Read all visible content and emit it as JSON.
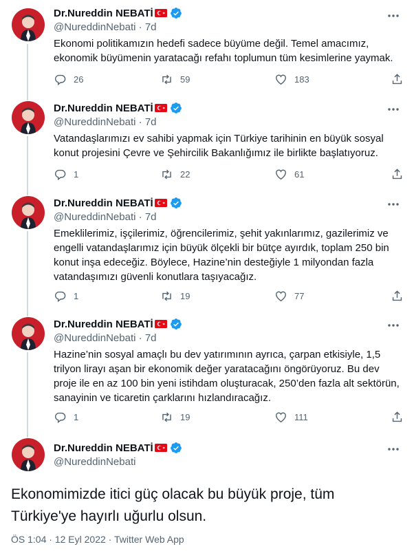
{
  "colors": {
    "verified": "#1d9bf0",
    "muted": "#536471",
    "text": "#0f1419",
    "thread_line": "#cfd9de",
    "flag_red": "#e30a17"
  },
  "icons": {
    "reply": "speech-bubble-icon",
    "retweet": "retweet-arrows-icon",
    "like": "heart-icon",
    "share": "share-icon",
    "more": "more-dots-icon",
    "verified": "verified-badge-icon",
    "flag": "turkey-flag-icon"
  },
  "author": {
    "name": "Dr.Nureddin NEBATİ",
    "handle": "@NureddinNebati"
  },
  "tweets": [
    {
      "age": "7d",
      "text": "Ekonomi politikamızın hedefi sadece büyüme değil. Temel amacımız, ekonomik büyümenin yaratacağı refahı toplumun tüm kesimlerine yaymak.",
      "replies": "26",
      "retweets": "59",
      "likes": "183"
    },
    {
      "age": "7d",
      "text": "Vatandaşlarımızı ev sahibi yapmak için Türkiye tarihinin en büyük sosyal konut projesini Çevre ve Şehircilik Bakanlığımız ile birlikte başlatıyoruz.",
      "replies": "1",
      "retweets": "22",
      "likes": "61"
    },
    {
      "age": "7d",
      "text": "Emeklilerimiz, işçilerimiz, öğrencilerimiz, şehit yakınlarımız, gazilerimiz ve engelli vatandaşlarımız için büyük ölçekli bir bütçe ayırdık, toplam 250 bin konut inşa edeceğiz. Böylece, Hazine’nin desteğiyle 1 milyondan fazla vatandaşımızı güvenli konutlara taşıyacağız.",
      "replies": "1",
      "retweets": "19",
      "likes": "77"
    },
    {
      "age": "7d",
      "text": "Hazine’nin sosyal amaçlı bu dev yatırımının ayrıca, çarpan etkisiyle, 1,5 trilyon lirayı aşan bir ekonomik değer yaratacağını öngörüyoruz. Bu dev proje ile en az 100 bin yeni istihdam oluşturacak, 250’den fazla alt sektörün, sanayinin ve ticaretin çarklarını hızlandıracağız.",
      "replies": "1",
      "retweets": "19",
      "likes": "111"
    }
  ],
  "main_tweet": {
    "text": "Ekonomimizde itici güç olacak bu büyük proje, tüm Türkiye'ye hayırlı uğurlu olsun.",
    "time": "ÖS 1:04",
    "date": "12 Eyl 2022",
    "separator": "·",
    "source": "Twitter Web App"
  }
}
